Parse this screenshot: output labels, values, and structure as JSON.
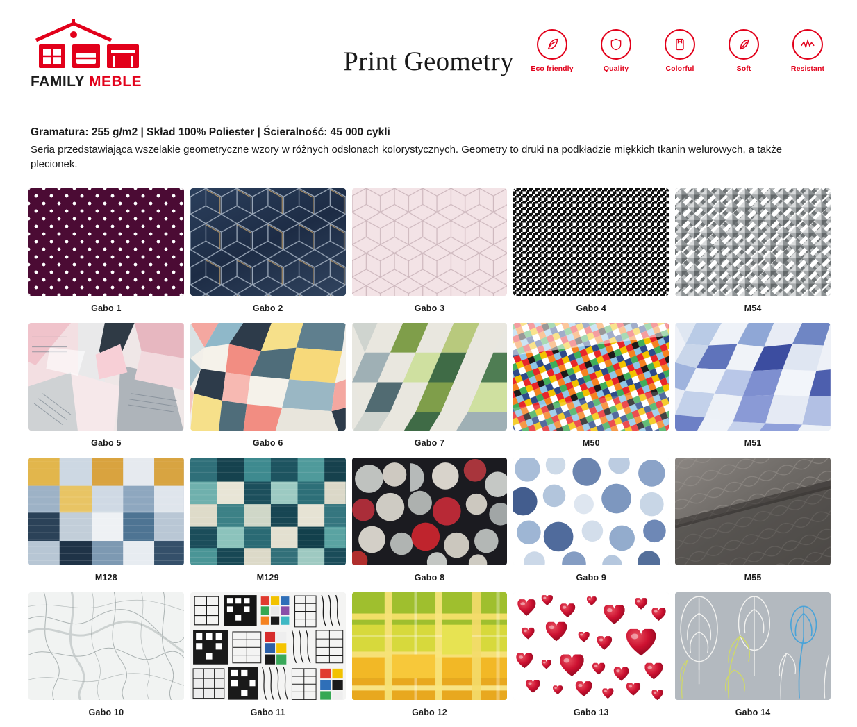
{
  "header": {
    "brand_first": "FAMILY",
    "brand_second": "MEBLE",
    "title": "Print Geometry",
    "badges": [
      {
        "label": "Eco friendly",
        "icon": "leaf-icon"
      },
      {
        "label": "Quality",
        "icon": "shield-icon"
      },
      {
        "label": "Colorful",
        "icon": "palette-icon"
      },
      {
        "label": "Soft",
        "icon": "feather-icon"
      },
      {
        "label": "Resistant",
        "icon": "zigzag-icon"
      }
    ],
    "accent_color": "#e2001a"
  },
  "description": {
    "specs": "Gramatura: 255 g/m2 | Skład 100% Poliester | Ścieralność: 45 000 cykli",
    "text": "Seria przedstawiająca wszelakie geometryczne wzory w różnych odsłonach kolorystycznych. Geometry to druki na podkładzie miękkich tkanin welurowych, a także plecionek."
  },
  "swatches": [
    {
      "label": "Gabo 1",
      "pattern": "p-gabo1"
    },
    {
      "label": "Gabo 2",
      "pattern": "p-gabo2"
    },
    {
      "label": "Gabo 3",
      "pattern": "p-gabo3"
    },
    {
      "label": "Gabo 4",
      "pattern": "p-gabo4"
    },
    {
      "label": "M54",
      "pattern": "p-m54"
    },
    {
      "label": "Gabo 5",
      "pattern": "p-gabo5"
    },
    {
      "label": "Gabo 6",
      "pattern": "p-gabo6"
    },
    {
      "label": "Gabo 7",
      "pattern": "p-gabo7"
    },
    {
      "label": "M50",
      "pattern": "p-m50"
    },
    {
      "label": "M51",
      "pattern": "p-m51"
    },
    {
      "label": "M128",
      "pattern": "p-m128"
    },
    {
      "label": "M129",
      "pattern": "p-m129"
    },
    {
      "label": "Gabo 8",
      "pattern": "p-gabo8"
    },
    {
      "label": "Gabo 9",
      "pattern": "p-gabo9"
    },
    {
      "label": "M55",
      "pattern": "p-m55"
    },
    {
      "label": "Gabo 10",
      "pattern": "p-gabo10"
    },
    {
      "label": "Gabo 11",
      "pattern": "p-gabo11"
    },
    {
      "label": "Gabo 12",
      "pattern": "p-gabo12"
    },
    {
      "label": "Gabo 13",
      "pattern": "p-gabo13"
    },
    {
      "label": "Gabo 14",
      "pattern": "p-gabo14"
    }
  ]
}
